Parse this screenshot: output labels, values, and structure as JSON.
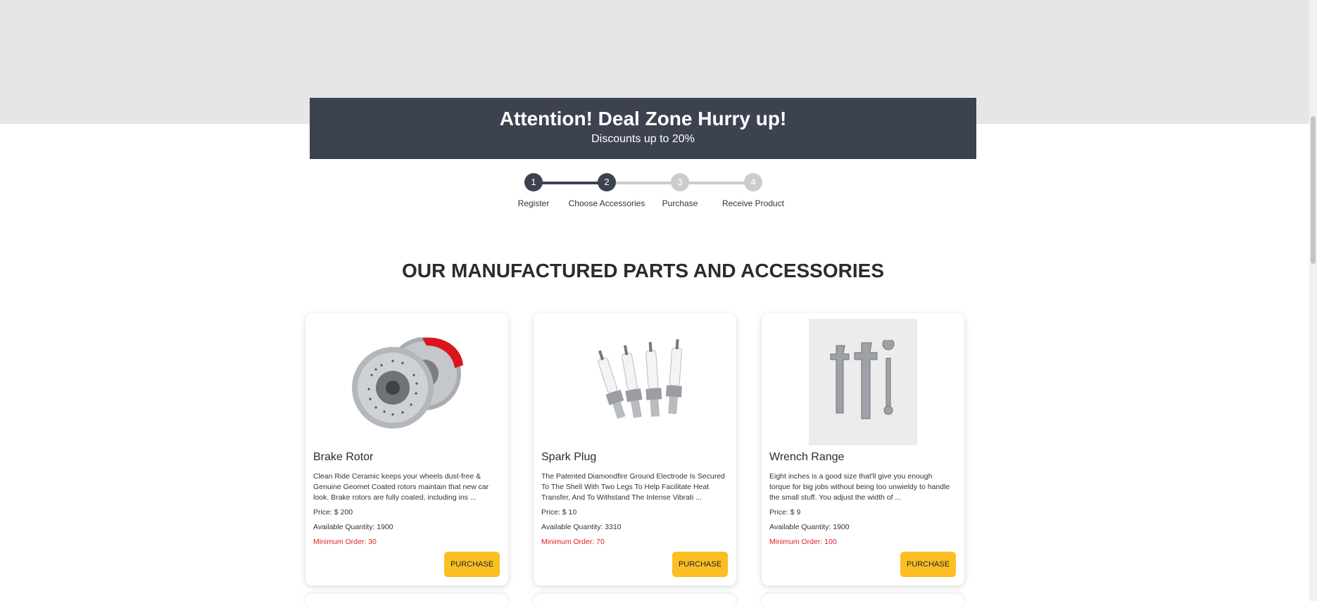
{
  "banner": {
    "title": "Attention! Deal Zone Hurry up!",
    "subtitle": "Discounts up to 20%",
    "background": "#3c4250"
  },
  "stepper": {
    "active_color": "#3c4250",
    "inactive_color": "#cccccc",
    "steps": [
      {
        "number": "1",
        "label": "Register",
        "active": true
      },
      {
        "number": "2",
        "label": "Choose Accessories",
        "active": true
      },
      {
        "number": "3",
        "label": "Purchase",
        "active": false
      },
      {
        "number": "4",
        "label": "Receive Product",
        "active": false
      }
    ]
  },
  "section": {
    "title": "OUR MANUFACTURED PARTS AND ACCESSORIES"
  },
  "products": [
    {
      "name": "Brake Rotor",
      "image": "brake-rotor-image",
      "description": "Clean Ride Ceramic keeps your wheels dust-free & Genuine Geomet Coated rotors maintain that new car look. Brake rotors are fully coated, including ins ...",
      "price": "Price: $ 200",
      "quantity": "Available Quantity: 1900",
      "min_order": "Minimum Order: 30",
      "button": "PURCHASE"
    },
    {
      "name": "Spark Plug",
      "image": "spark-plug-image",
      "description": "The Patented Diamondfire Ground Electrode Is Secured To The Shell With Two Legs To Help Facilitate Heat Transfer, And To Withstand The Intense Vibrati ...",
      "price": "Price: $ 10",
      "quantity": "Available Quantity: 3310",
      "min_order": "Minimum Order: 70",
      "button": "PURCHASE"
    },
    {
      "name": "Wrench Range",
      "image": "wrench-image",
      "description": "Eight inches is a good size that'll give you enough torque for big jobs without being too unwieldy to handle the small stuff. You adjust the width of ...",
      "price": "Price: $ 9",
      "quantity": "Available Quantity: 1900",
      "min_order": "Minimum Order: 100",
      "button": "PURCHASE"
    }
  ],
  "colors": {
    "accent_button": "#fbbf24",
    "min_order_text": "#e02020",
    "top_band": "#e6e6e6"
  }
}
